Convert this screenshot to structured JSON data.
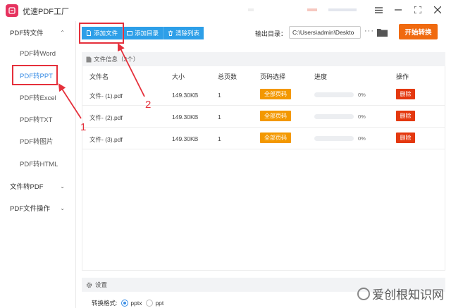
{
  "app": {
    "title": "优速PDF工厂"
  },
  "window": {
    "menu_icon": "hamburger-icon",
    "minimize_icon": "minimize-icon",
    "maximize_icon": "maximize-icon",
    "close_icon": "close-icon"
  },
  "sidebar": {
    "groups": [
      {
        "label": "PDF转文件",
        "chevron": "chevron-up-icon"
      },
      {
        "label": "文件转PDF",
        "chevron": "chevron-down-icon"
      },
      {
        "label": "PDF文件操作",
        "chevron": "chevron-down-icon"
      }
    ],
    "items": [
      {
        "label": "PDF转Word"
      },
      {
        "label": "PDF转PPT",
        "active": true
      },
      {
        "label": "PDF转Excel"
      },
      {
        "label": "PDF转TXT"
      },
      {
        "label": "PDF转图片"
      },
      {
        "label": "PDF转HTML"
      }
    ]
  },
  "toolbar": {
    "add_file_label": "添加文件",
    "add_folder_label": "添加目录",
    "clear_list_label": "清除列表",
    "output_label": "输出目录：",
    "output_path": "C:\\Users\\admin\\Deskto",
    "more_label": "···",
    "start_label": "开始转换"
  },
  "file_info": {
    "label": "文件信息（3个）"
  },
  "table": {
    "columns": [
      "文件名",
      "大小",
      "总页数",
      "页码选择",
      "进度",
      "操作"
    ],
    "rows": [
      {
        "name": "文件- (1).pdf",
        "size": "149.30KB",
        "pages": "1",
        "page_select": "全部页码",
        "progress": 0,
        "progress_text": "0%",
        "action": "删除"
      },
      {
        "name": "文件- (2).pdf",
        "size": "149.30KB",
        "pages": "1",
        "page_select": "全部页码",
        "progress": 0,
        "progress_text": "0%",
        "action": "删除"
      },
      {
        "name": "文件- (3).pdf",
        "size": "149.30KB",
        "pages": "1",
        "page_select": "全部页码",
        "progress": 0,
        "progress_text": "0%",
        "action": "删除"
      }
    ]
  },
  "settings": {
    "label": "设置",
    "format_label": "转换格式:",
    "options": [
      {
        "label": "pptx",
        "selected": true
      },
      {
        "label": "ppt",
        "selected": false
      }
    ]
  },
  "annotations": {
    "step1": "1",
    "step2": "2"
  },
  "watermark": {
    "text": "爱创根知识网"
  },
  "colors": {
    "accent_blue": "#2d9fe8",
    "start_orange": "#f06a0f",
    "pages_orange": "#f39800",
    "delete_red": "#e4380f",
    "annotation_red": "#e5303b",
    "brand_pink": "#e6335f"
  }
}
